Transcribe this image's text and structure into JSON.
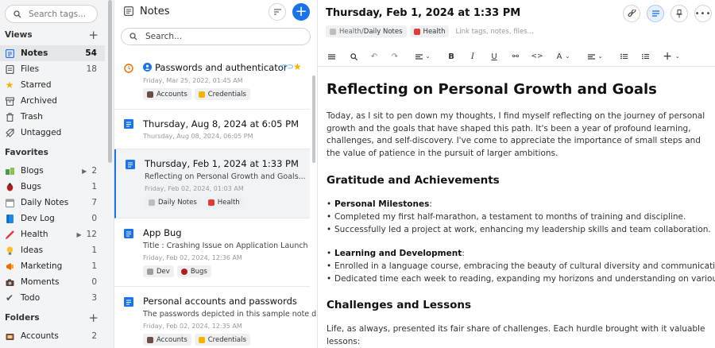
{
  "sidebar": {
    "search_placeholder": "Search tags...",
    "views_header": "Views",
    "views": [
      {
        "label": "Notes",
        "count": "54",
        "icon": "notes-icon"
      },
      {
        "label": "Files",
        "count": "18",
        "icon": "files-icon"
      },
      {
        "label": "Starred",
        "count": "",
        "icon": "star-icon"
      },
      {
        "label": "Archived",
        "count": "",
        "icon": "archive-icon"
      },
      {
        "label": "Trash",
        "count": "",
        "icon": "trash-icon"
      },
      {
        "label": "Untagged",
        "count": "",
        "icon": "untagged-icon"
      }
    ],
    "favorites_header": "Favorites",
    "favorites": [
      {
        "label": "Blogs",
        "count": "2",
        "expandable": true,
        "color": "#4caf50"
      },
      {
        "label": "Bugs",
        "count": "1",
        "expandable": false,
        "color": "#c62828"
      },
      {
        "label": "Daily Notes",
        "count": "7",
        "expandable": false,
        "color": "#9e9e9e"
      },
      {
        "label": "Dev Log",
        "count": "0",
        "expandable": false,
        "color": "#1e88e5"
      },
      {
        "label": "Health",
        "count": "12",
        "expandable": true,
        "color": "#e53935"
      },
      {
        "label": "Ideas",
        "count": "1",
        "expandable": false,
        "color": "#fbc02d"
      },
      {
        "label": "Marketing",
        "count": "1",
        "expandable": false,
        "color": "#ef6c00"
      },
      {
        "label": "Moments",
        "count": "0",
        "expandable": false,
        "color": "#6d4c41"
      },
      {
        "label": "Todo",
        "count": "3",
        "expandable": false,
        "color": "#555555"
      }
    ],
    "folders_header": "Folders",
    "folders": [
      {
        "label": "Accounts",
        "count": "2",
        "color": "#8d6e63"
      }
    ]
  },
  "list": {
    "title": "Notes",
    "search_placeholder": "Search...",
    "notes": [
      {
        "title": "Passwords and authenticator",
        "snippet": "",
        "date": "Friday, Mar 25, 2022, 01:45 AM",
        "tags": [
          "Accounts",
          "Credentials"
        ],
        "icon": "clock-icon"
      },
      {
        "title": "Thursday, Aug 8, 2024 at 6:05 PM",
        "snippet": "",
        "date": "Thursday, Aug 08, 2024, 06:05 PM",
        "tags": [],
        "icon": "note-icon"
      },
      {
        "title": "Thursday, Feb 1, 2024 at 1:33 PM",
        "snippet": "Reflecting on Personal Growth and Goals...",
        "date": "Friday, Feb 02, 2024, 01:03 AM",
        "tags": [
          "Daily Notes",
          "Health"
        ],
        "icon": "note-icon"
      },
      {
        "title": "App Bug",
        "snippet": "Title : Crashing Issue on Application Launch",
        "date": "Friday, Feb 02, 2024, 12:36 AM",
        "tags": [
          "Dev",
          "Bugs"
        ],
        "icon": "note-icon"
      },
      {
        "title": "Personal accounts and passwords",
        "snippet": "The passwords depicted in this sample note d...",
        "date": "Friday, Feb 02, 2024, 12:35 AM",
        "tags": [
          "Accounts",
          "Credentials"
        ],
        "icon": "note-icon"
      }
    ]
  },
  "editor": {
    "title": "Thursday, Feb 1, 2024 at 1:33 PM",
    "tag_path_1": "Health/",
    "tag_path_2": "Daily Notes",
    "tag_2": "Health",
    "link_placeholder": "Link tags, notes, files...",
    "toolbar": {
      "text_style": "A"
    },
    "doc": {
      "h1": "Reflecting on Personal Growth and Goals",
      "intro": "Today, as I sit to pen down my thoughts, I find myself reflecting on the journey of personal growth and the goals that have shaped this path. It's been a year of profound learning, challenges, and self-discovery. I've come to appreciate the importance of small steps and the value of patience in the pursuit of larger ambitions.",
      "h2_a": "Gratitude and Achievements",
      "group1_title": "Personal Milestones",
      "group1_items": [
        "Completed my first half-marathon, a testament to months of training and discipline.",
        "Successfully led a project at work, enhancing my leadership skills and team collaboration."
      ],
      "group2_title": "Learning and Development",
      "group2_items": [
        "Enrolled in a language course, embracing the beauty of cultural diversity and communication.",
        "Dedicated time each week to reading, expanding my horizons and understanding on various subjects."
      ],
      "h2_b": "Challenges and Lessons",
      "outro": "Life, as always, presented its fair share of challenges. Each hurdle brought with it valuable lessons:"
    }
  },
  "colors": {
    "accent": "#1a73e8",
    "sidebar_bg": "#f3f4f6"
  }
}
